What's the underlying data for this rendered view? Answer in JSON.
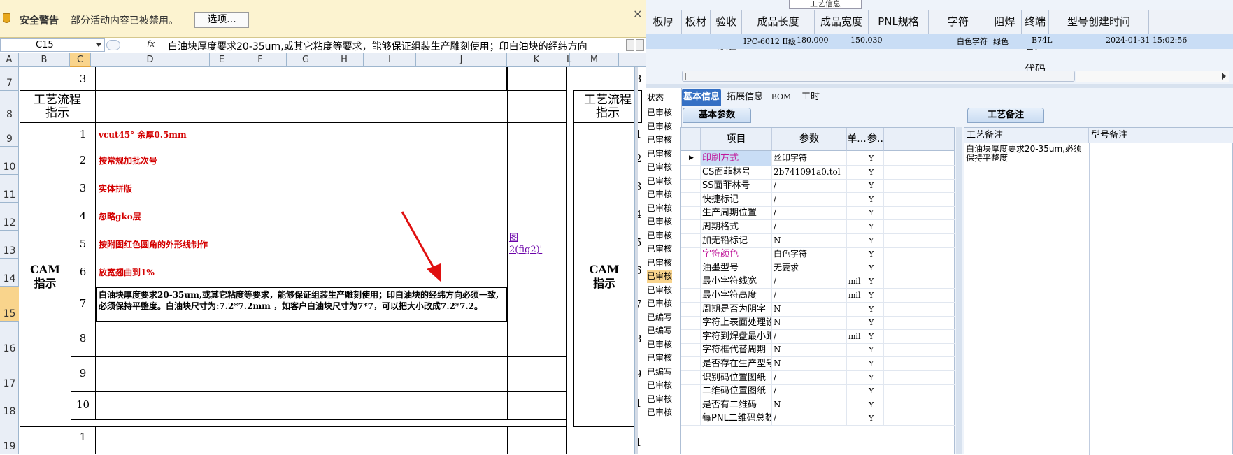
{
  "security": {
    "title": "安全警告",
    "message": "部分活动内容已被禁用。",
    "options_label": "选项...",
    "close": "×"
  },
  "formula": {
    "cell": "C15",
    "fx": "fx",
    "content": "白油块厚度要求20-35um,或其它粘度等要求，能够保证组装生产雕刻使用；印白油块的经纬方向"
  },
  "columns": [
    "A",
    "B",
    "C",
    "D",
    "E",
    "F",
    "G",
    "H",
    "I",
    "J",
    "K",
    "L",
    "M"
  ],
  "rows": [
    "7",
    "8",
    "9",
    "10",
    "11",
    "12",
    "13",
    "14",
    "15",
    "16",
    "17",
    "18",
    "19"
  ],
  "sheet": {
    "row7_num": "3",
    "process_label": "工艺流程\n指示",
    "cam_label": "CAM\n指示",
    "items": [
      {
        "n": "1",
        "text": "vcut45° 余厚0.5mm"
      },
      {
        "n": "2",
        "text": "按常规加批次号"
      },
      {
        "n": "3",
        "text": "实体拼版"
      },
      {
        "n": "4",
        "text": "忽略gko层"
      },
      {
        "n": "5",
        "text": "按附图红色圆角的外形线制作"
      },
      {
        "n": "6",
        "text": "放宽翘曲到1%"
      },
      {
        "n": "7",
        "text": "白油块厚度要求20-35um,或其它粘度等要求，能够保证组装生产雕刻使用；印白油块的经纬方向必须一致, 必须保持平整度。白油块尺寸为:7.2*7.2mm ，如客户白油块尺寸为7*7，可以把大小改成7.2*7.2。"
      },
      {
        "n": "8",
        "text": ""
      },
      {
        "n": "9",
        "text": ""
      },
      {
        "n": "10",
        "text": ""
      }
    ],
    "row19_num": "1",
    "link_text": "图\n2(fig2)'",
    "right_nums": [
      "3",
      "1",
      "2",
      "3",
      "4",
      "5",
      "6",
      "7",
      "8",
      "9",
      "1",
      "1"
    ]
  },
  "app": {
    "top_tab": "工艺信息",
    "headers": [
      "板厚",
      "板材",
      "验收标准",
      "成品长度",
      "成品宽度",
      "PNL规格",
      "字符",
      "阻焊",
      "终端客户代码",
      "型号创建时间"
    ],
    "row": {
      "standard": "IPC-6012 II级",
      "length": "180.000",
      "width": "150.030",
      "char": "白色字符",
      "mask": "绿色",
      "code": "B74L",
      "created": "2024-01-31 15:02:56"
    },
    "status_label": "状态",
    "status_items": [
      "已审核",
      "已审核",
      "已审核",
      "已审核",
      "已审核",
      "已审核",
      "已审核",
      "已审核",
      "已审核",
      "已审核",
      "已审核",
      "已审核",
      "已审核",
      "已审核",
      "已审核",
      "已编写",
      "已编写",
      "已审核",
      "已审核",
      "已编写",
      "已审核",
      "已审核",
      "已审核"
    ],
    "tabs": [
      "基本信息",
      "拓展信息",
      "BOM",
      "工时"
    ],
    "subtab": "基本参数",
    "notes_tab": "工艺备注",
    "param_headers": [
      "项目",
      "参数",
      "单...",
      "参..."
    ],
    "params": [
      {
        "k": "印刷方式",
        "v": "丝印字符",
        "u": "",
        "f": "Y",
        "hl": true,
        "sel": true
      },
      {
        "k": "CS面菲林号",
        "v": "2b741091a0.tol",
        "u": "",
        "f": "Y",
        "hl": false
      },
      {
        "k": "SS面菲林号",
        "v": "/",
        "u": "",
        "f": "Y",
        "hl": false
      },
      {
        "k": "快捷标记",
        "v": "/",
        "u": "",
        "f": "Y",
        "hl": false
      },
      {
        "k": "生产周期位置",
        "v": "/",
        "u": "",
        "f": "Y",
        "hl": false
      },
      {
        "k": "周期格式",
        "v": "/",
        "u": "",
        "f": "Y",
        "hl": false
      },
      {
        "k": "加无铅标记",
        "v": "N",
        "u": "",
        "f": "Y",
        "hl": false
      },
      {
        "k": "字符颜色",
        "v": "白色字符",
        "u": "",
        "f": "Y",
        "hl": true
      },
      {
        "k": "油墨型号",
        "v": "无要求",
        "u": "",
        "f": "Y",
        "hl": false
      },
      {
        "k": "最小字符线宽",
        "v": "/",
        "u": "mil",
        "f": "Y",
        "hl": false
      },
      {
        "k": "最小字符高度",
        "v": "/",
        "u": "mil",
        "f": "Y",
        "hl": false
      },
      {
        "k": "周期是否为阴字",
        "v": "N",
        "u": "",
        "f": "Y",
        "hl": false
      },
      {
        "k": "字符上表面处理设计",
        "v": "N",
        "u": "",
        "f": "Y",
        "hl": false
      },
      {
        "k": "字符到焊盘最小距离",
        "v": "/",
        "u": "mil",
        "f": "Y",
        "hl": false
      },
      {
        "k": "字符框代替周期",
        "v": "N",
        "u": "",
        "f": "Y",
        "hl": false
      },
      {
        "k": "是否存在生产型号",
        "v": "N",
        "u": "",
        "f": "Y",
        "hl": false
      },
      {
        "k": "识别码位置图纸",
        "v": "/",
        "u": "",
        "f": "Y",
        "hl": false
      },
      {
        "k": "二维码位置图纸",
        "v": "/",
        "u": "",
        "f": "Y",
        "hl": false
      },
      {
        "k": "是否有二维码",
        "v": "N",
        "u": "",
        "f": "Y",
        "hl": false
      },
      {
        "k": "每PNL二维码总数",
        "v": "/",
        "u": "",
        "f": "Y",
        "hl": false
      }
    ],
    "notes_headers": [
      "工艺备注",
      "型号备注"
    ],
    "note_text": "白油块厚度要求20-35um,必须保持平整度",
    "colors": {
      "accent": "#3570c4",
      "highlight": "#c0189a",
      "red_text": "#d40000",
      "selection": "#f9d48c"
    }
  }
}
